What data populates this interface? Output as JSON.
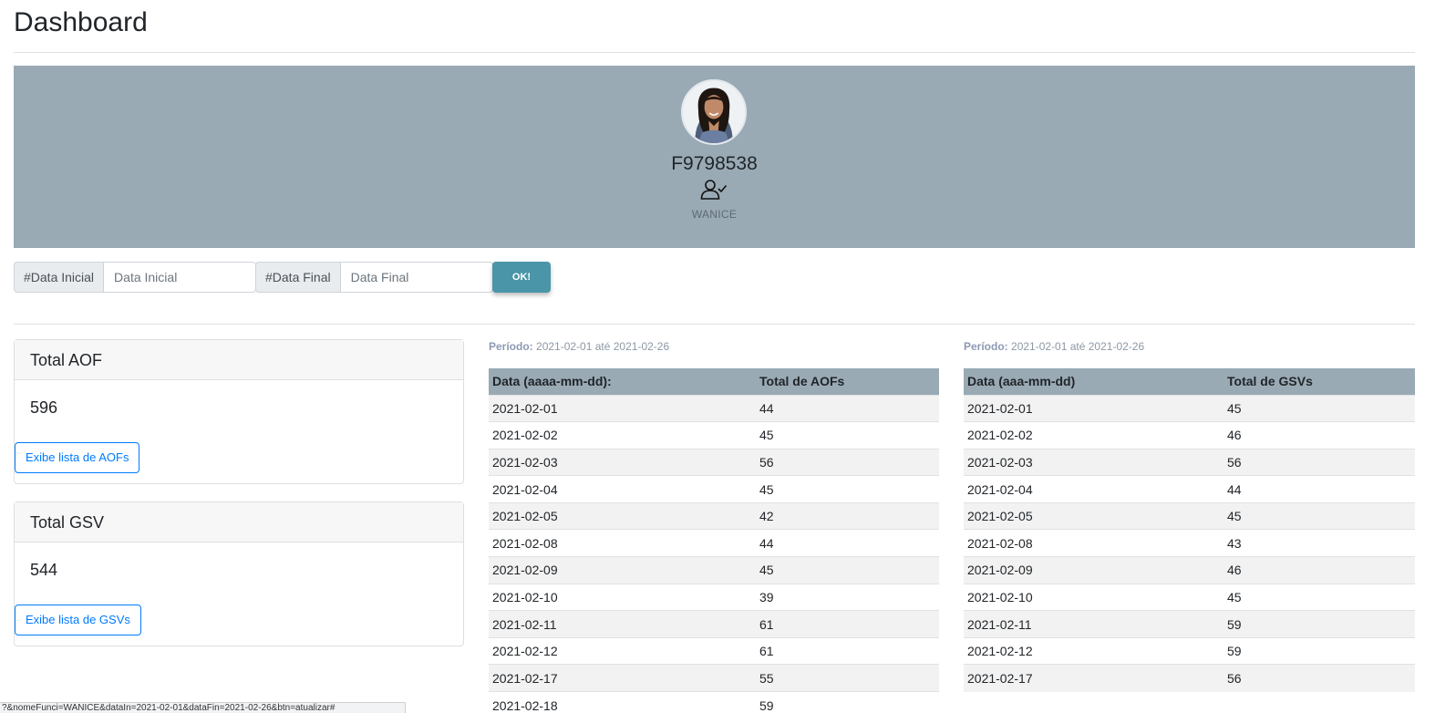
{
  "page": {
    "title": "Dashboard"
  },
  "profile": {
    "user_id": "F9798538",
    "name": "WANICE"
  },
  "filters": {
    "start": {
      "addon": "#Data Inicial",
      "placeholder": "Data Inicial"
    },
    "end": {
      "addon": "#Data Final",
      "placeholder": "Data Final"
    },
    "submit_label": "OK!"
  },
  "cards": {
    "aof": {
      "title": "Total AOF",
      "value": "596",
      "button": "Exibe lista de AOFs"
    },
    "gsv": {
      "title": "Total GSV",
      "value": "544",
      "button": "Exibe lista de GSVs"
    }
  },
  "aof_table": {
    "period_label": "Período:",
    "period_value": "2021-02-01 até 2021-02-26",
    "headers": [
      "Data (aaaa-mm-dd):",
      "Total de AOFs"
    ],
    "rows": [
      [
        "2021-02-01",
        "44"
      ],
      [
        "2021-02-02",
        "45"
      ],
      [
        "2021-02-03",
        "56"
      ],
      [
        "2021-02-04",
        "45"
      ],
      [
        "2021-02-05",
        "42"
      ],
      [
        "2021-02-08",
        "44"
      ],
      [
        "2021-02-09",
        "45"
      ],
      [
        "2021-02-10",
        "39"
      ],
      [
        "2021-02-11",
        "61"
      ],
      [
        "2021-02-12",
        "61"
      ],
      [
        "2021-02-17",
        "55"
      ],
      [
        "2021-02-18",
        "59"
      ]
    ]
  },
  "gsv_table": {
    "period_label": "Período:",
    "period_value": "2021-02-01 até 2021-02-26",
    "headers": [
      "Data (aaa-mm-dd)",
      "Total de GSVs"
    ],
    "rows": [
      [
        "2021-02-01",
        "45"
      ],
      [
        "2021-02-02",
        "46"
      ],
      [
        "2021-02-03",
        "56"
      ],
      [
        "2021-02-04",
        "44"
      ],
      [
        "2021-02-05",
        "45"
      ],
      [
        "2021-02-08",
        "43"
      ],
      [
        "2021-02-09",
        "46"
      ],
      [
        "2021-02-10",
        "45"
      ],
      [
        "2021-02-11",
        "59"
      ],
      [
        "2021-02-12",
        "59"
      ],
      [
        "2021-02-17",
        "56"
      ]
    ]
  },
  "status_bar": {
    "url": "?&nomeFunci=WANICE&dataIn=2021-02-01&dataFin=2021-02-26&btn=atualizar#"
  },
  "icons": {
    "avatar": "user-photo",
    "user_check": "user-check-icon"
  },
  "colors": {
    "profile_bg": "#99aab5",
    "table_header_bg": "#99aab5",
    "primary": "#007bff",
    "ok_button": "#4a95a8"
  }
}
